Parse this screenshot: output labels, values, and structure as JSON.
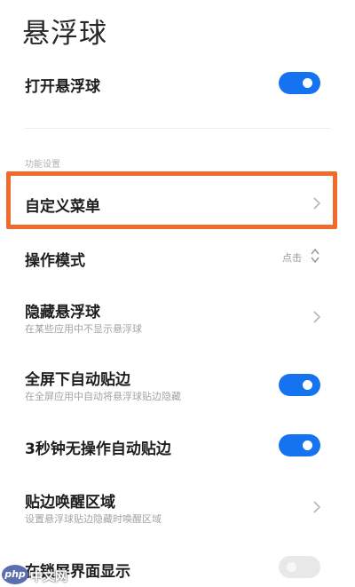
{
  "page": {
    "title": "悬浮球"
  },
  "open_floating_ball": {
    "label": "打开悬浮球",
    "enabled": true
  },
  "section": {
    "label": "功能设置"
  },
  "items": {
    "custom_menu": {
      "label": "自定义菜单"
    },
    "operation_mode": {
      "label": "操作模式",
      "value": "点击"
    },
    "hide_ball": {
      "label": "隐藏悬浮球",
      "desc": "在某些应用中不显示悬浮球"
    },
    "fullscreen_edge": {
      "label": "全屏下自动贴边",
      "desc": "在全屏应用中自动将悬浮球贴边隐藏",
      "enabled": true
    },
    "auto_edge_3s": {
      "label": "3秒钟无操作自动贴边",
      "enabled": true
    },
    "edge_wake_area": {
      "label": "贴边唤醒区域",
      "desc": "设置悬浮球贴边隐藏时唤醒区域"
    },
    "lockscreen_show": {
      "label": "在锁屏界面显示",
      "enabled": false
    }
  },
  "watermark": {
    "logo_text": "php",
    "site_text": "中文网"
  },
  "colors": {
    "toggle_on": "#1673f0",
    "toggle_off": "#e8e8e8",
    "highlight": "#f06a2a"
  }
}
